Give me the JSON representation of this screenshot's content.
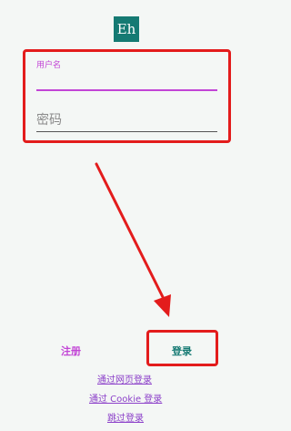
{
  "app": {
    "logo_text": "Eh"
  },
  "form": {
    "username_label": "用户名",
    "password_placeholder": "密码"
  },
  "actions": {
    "register_label": "注册",
    "login_label": "登录"
  },
  "links": {
    "web_login": "通过网页登录",
    "cookie_login": "通过 Cookie 登录",
    "skip_login": "跳过登录"
  },
  "annotations": {
    "highlight_color": "#e31c1c"
  },
  "colors": {
    "brand": "#157a73",
    "accent": "#c245d6",
    "link": "#8b3fc9",
    "background": "#f4f7f5"
  }
}
